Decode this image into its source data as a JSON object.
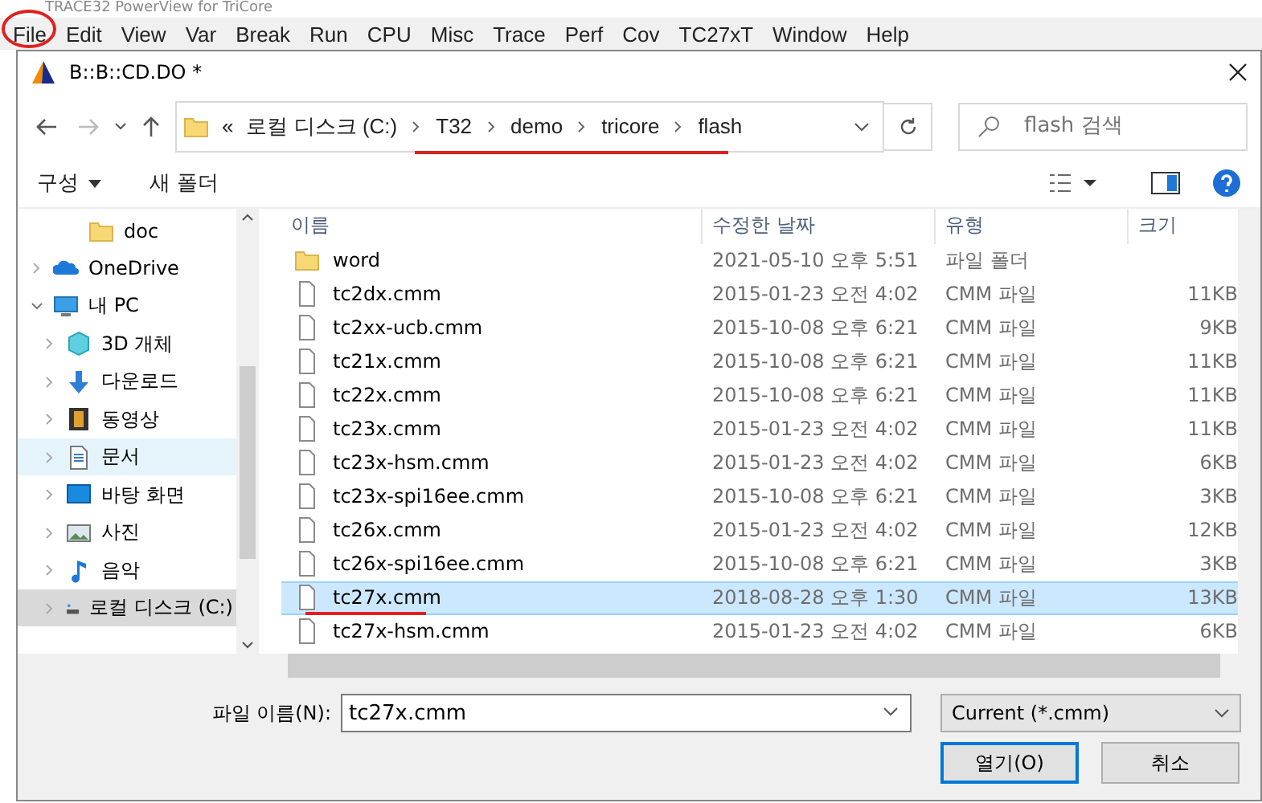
{
  "app_title": "TRACE32 PowerView for TriCore",
  "menu": [
    "File",
    "Edit",
    "View",
    "Var",
    "Break",
    "Run",
    "CPU",
    "Misc",
    "Trace",
    "Perf",
    "Cov",
    "TC27xT",
    "Window",
    "Help"
  ],
  "dialog": {
    "title": "B::B::CD.DO *",
    "path": {
      "overflow": "«",
      "segments": [
        "로컬 디스크 (C:)",
        "T32",
        "demo",
        "tricore",
        "flash"
      ]
    },
    "search": {
      "placeholder": "flash 검색"
    },
    "toolbar": {
      "organize": "구성",
      "new_folder": "새 폴더"
    },
    "sidebar": {
      "items": [
        {
          "label": "doc",
          "kind": "folder",
          "selected": false,
          "hovered": false
        },
        {
          "label": "OneDrive",
          "kind": "cloud",
          "expanded": false,
          "selected": false,
          "hovered": false
        },
        {
          "label": "내 PC",
          "kind": "pc",
          "expanded": true,
          "selected": false,
          "hovered": false,
          "children": [
            {
              "label": "3D 개체",
              "kind": "cube",
              "expanded": false,
              "selected": false,
              "hovered": false
            },
            {
              "label": "다운로드",
              "kind": "download",
              "expanded": false,
              "selected": false,
              "hovered": false
            },
            {
              "label": "동영상",
              "kind": "film",
              "expanded": false,
              "selected": false,
              "hovered": false
            },
            {
              "label": "문서",
              "kind": "document",
              "expanded": false,
              "selected": false,
              "hovered": true
            },
            {
              "label": "바탕 화면",
              "kind": "desktop",
              "expanded": false,
              "selected": false,
              "hovered": false
            },
            {
              "label": "사진",
              "kind": "picture",
              "expanded": false,
              "selected": false,
              "hovered": false
            },
            {
              "label": "음악",
              "kind": "music",
              "expanded": false,
              "selected": false,
              "hovered": false
            },
            {
              "label": "로컬 디스크 (C:)",
              "kind": "drive",
              "expanded": false,
              "selected": true,
              "hovered": false
            }
          ]
        }
      ]
    },
    "table": {
      "columns": [
        "이름",
        "수정한 날짜",
        "유형",
        "크기"
      ],
      "rows": [
        {
          "kind": "folder",
          "name": "word",
          "date": "2021-05-10 오후 5:51",
          "type": "파일 폴더",
          "selected": false
        },
        {
          "kind": "file",
          "name": "tc2dx.cmm",
          "date": "2015-01-23 오전 4:02",
          "type": "CMM 파일",
          "size": "11KB",
          "selected": false
        },
        {
          "kind": "file",
          "name": "tc2xx-ucb.cmm",
          "date": "2015-10-08 오후 6:21",
          "type": "CMM 파일",
          "size": "9KB",
          "selected": false
        },
        {
          "kind": "file",
          "name": "tc21x.cmm",
          "date": "2015-10-08 오후 6:21",
          "type": "CMM 파일",
          "size": "11KB",
          "selected": false
        },
        {
          "kind": "file",
          "name": "tc22x.cmm",
          "date": "2015-10-08 오후 6:21",
          "type": "CMM 파일",
          "size": "11KB",
          "selected": false
        },
        {
          "kind": "file",
          "name": "tc23x.cmm",
          "date": "2015-01-23 오전 4:02",
          "type": "CMM 파일",
          "size": "11KB",
          "selected": false
        },
        {
          "kind": "file",
          "name": "tc23x-hsm.cmm",
          "date": "2015-01-23 오전 4:02",
          "type": "CMM 파일",
          "size": "6KB",
          "selected": false
        },
        {
          "kind": "file",
          "name": "tc23x-spi16ee.cmm",
          "date": "2015-10-08 오후 6:21",
          "type": "CMM 파일",
          "size": "3KB",
          "selected": false
        },
        {
          "kind": "file",
          "name": "tc26x.cmm",
          "date": "2015-01-23 오전 4:02",
          "type": "CMM 파일",
          "size": "12KB",
          "selected": false
        },
        {
          "kind": "file",
          "name": "tc26x-spi16ee.cmm",
          "date": "2015-10-08 오후 6:21",
          "type": "CMM 파일",
          "size": "3KB",
          "selected": false
        },
        {
          "kind": "file",
          "name": "tc27x.cmm",
          "date": "2018-08-28 오후 1:30",
          "type": "CMM 파일",
          "size": "13KB",
          "selected": true
        },
        {
          "kind": "file",
          "name": "tc27x-hsm.cmm",
          "date": "2015-01-23 오전 4:02",
          "type": "CMM 파일",
          "size": "6KB",
          "selected": false
        }
      ]
    },
    "filename": {
      "label": "파일 이름(N):",
      "value": "tc27x.cmm"
    },
    "filter": {
      "value": "Current (*.cmm)"
    },
    "buttons": [
      "열기(O)",
      "취소"
    ]
  }
}
